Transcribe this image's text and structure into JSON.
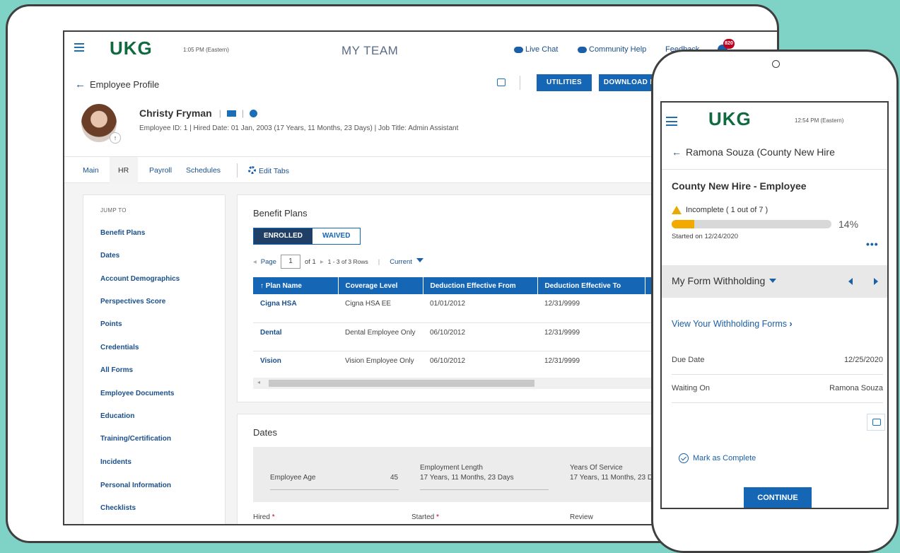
{
  "desktop": {
    "logo": "UKG",
    "time": "1:05 PM (Eastern)",
    "module_title": "MY TEAM",
    "live_chat": "Live Chat",
    "community_help": "Community Help",
    "feedback": "Feedback",
    "notif_count": "820",
    "back_label": "Employee Profile",
    "utilities": "UTILITIES",
    "download_pdf": "DOWNLOAD PDF",
    "employee": {
      "name": "Christy Fryman",
      "meta": "Employee ID: 1  |  Hired Date: 01 Jan, 2003 (17 Years, 11 Months, 23 Days)  |  Job Title: Admin Assistant"
    },
    "tabs": [
      "Main",
      "HR",
      "Payroll",
      "Schedules"
    ],
    "edit_tabs": "Edit Tabs",
    "jump_to": {
      "title": "JUMP TO",
      "links": [
        "Benefit Plans",
        "Dates",
        "Account Demographics",
        "Perspectives Score",
        "Points",
        "Credentials",
        "All Forms",
        "Employee Documents",
        "Education",
        "Training/Certification",
        "Incidents",
        "Personal Information",
        "Checklists"
      ]
    },
    "benefit_plans": {
      "title": "Benefit Plans",
      "enrolled": "ENROLLED",
      "waived": "WAIVED",
      "page_label": "Page",
      "page_value": "1",
      "of_label": "of 1",
      "rows_label": "1 - 3 of 3 Rows",
      "current_label": "Current",
      "columns": [
        "Plan Name",
        "Coverage Level",
        "Deduction Effective From",
        "Deduction Effective To"
      ],
      "rows": [
        [
          "Cigna HSA",
          "Cigna HSA EE",
          "01/01/2012",
          "12/31/9999"
        ],
        [
          "Dental",
          "Dental Employee Only",
          "06/10/2012",
          "12/31/9999"
        ],
        [
          "Vision",
          "Vision Employee Only",
          "06/10/2012",
          "12/31/9999"
        ]
      ]
    },
    "dates": {
      "title": "Dates",
      "employee_age_label": "Employee Age",
      "employee_age_value": "45",
      "employment_length_label": "Employment Length",
      "employment_length_value": "17 Years, 11 Months, 23 Days",
      "years_of_service_label": "Years Of Service",
      "years_of_service_value": "17 Years, 11 Months, 23 Days",
      "hired_label": "Hired",
      "started_label": "Started",
      "review_label": "Review"
    }
  },
  "phone": {
    "logo": "UKG",
    "time": "12:54 PM (Eastern)",
    "back_label": "Ramona Souza (County New Hire",
    "heading": "County New Hire - Employee",
    "status": "Incomplete ( 1 out of 7 )",
    "progress_fraction": 0.14,
    "progress_label": "14%",
    "started": "Started on 12/24/2020",
    "form_title": "My Form Withholding",
    "view_link": "View Your Withholding Forms",
    "due_date_label": "Due Date",
    "due_date_value": "12/25/2020",
    "waiting_on_label": "Waiting On",
    "waiting_on_value": "Ramona Souza",
    "mark_complete": "Mark as Complete",
    "continue": "CONTINUE"
  }
}
